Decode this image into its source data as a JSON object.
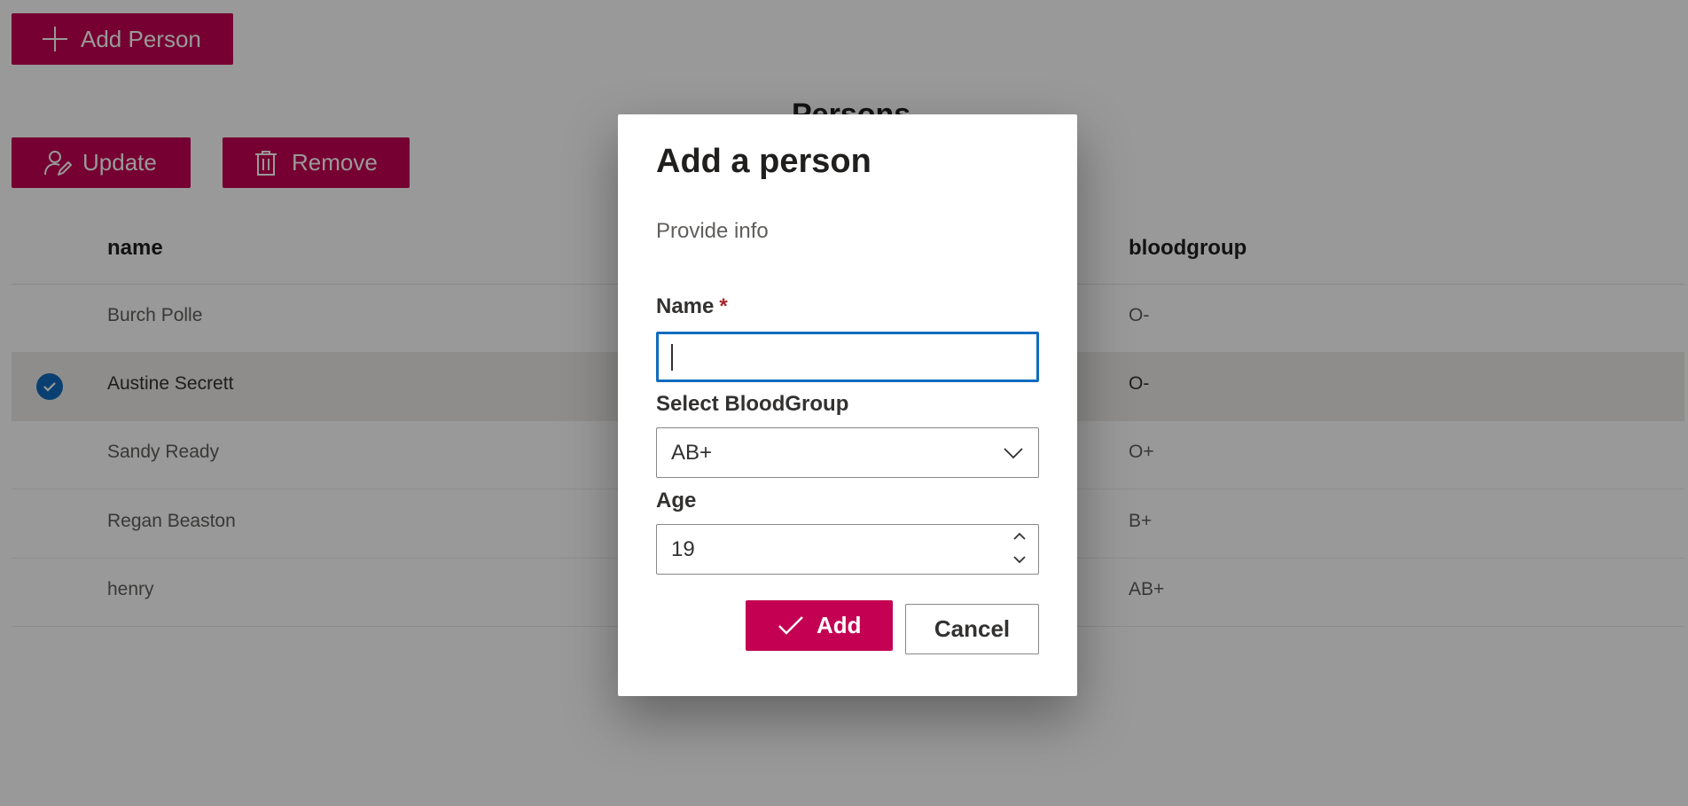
{
  "toolbar": {
    "add_person_label": "Add Person",
    "update_label": "Update",
    "remove_label": "Remove"
  },
  "page": {
    "title": "Persons"
  },
  "table": {
    "columns": [
      "name",
      "bloodgroup"
    ],
    "rows": [
      {
        "name": "Burch Polle",
        "bloodgroup": "O-",
        "selected": false
      },
      {
        "name": "Austine Secrett",
        "bloodgroup": "O-",
        "selected": true
      },
      {
        "name": "Sandy Ready",
        "bloodgroup": "O+",
        "selected": false
      },
      {
        "name": "Regan Beaston",
        "bloodgroup": "B+",
        "selected": false
      },
      {
        "name": "henry",
        "bloodgroup": "AB+",
        "selected": false
      }
    ]
  },
  "dialog": {
    "title": "Add a person",
    "subtitle": "Provide info",
    "name_label": "Name",
    "required_marker": "*",
    "name_value": "",
    "blood_label": "Select BloodGroup",
    "blood_value": "AB+",
    "age_label": "Age",
    "age_value": "19",
    "add_label": "Add",
    "cancel_label": "Cancel"
  },
  "icons": {
    "add_person": "plus-icon",
    "update": "person-edit-icon",
    "remove": "trash-icon",
    "row_selected": "checkmark-circle-icon",
    "select": "chevron-down-icon",
    "spin_up": "chevron-up-icon",
    "spin_down": "chevron-down-icon",
    "add": "checkmark-icon"
  },
  "colors": {
    "accent": "#c30052",
    "focus": "#0f6cbd",
    "required": "#a4262c",
    "selected_row": "#edebe9"
  }
}
